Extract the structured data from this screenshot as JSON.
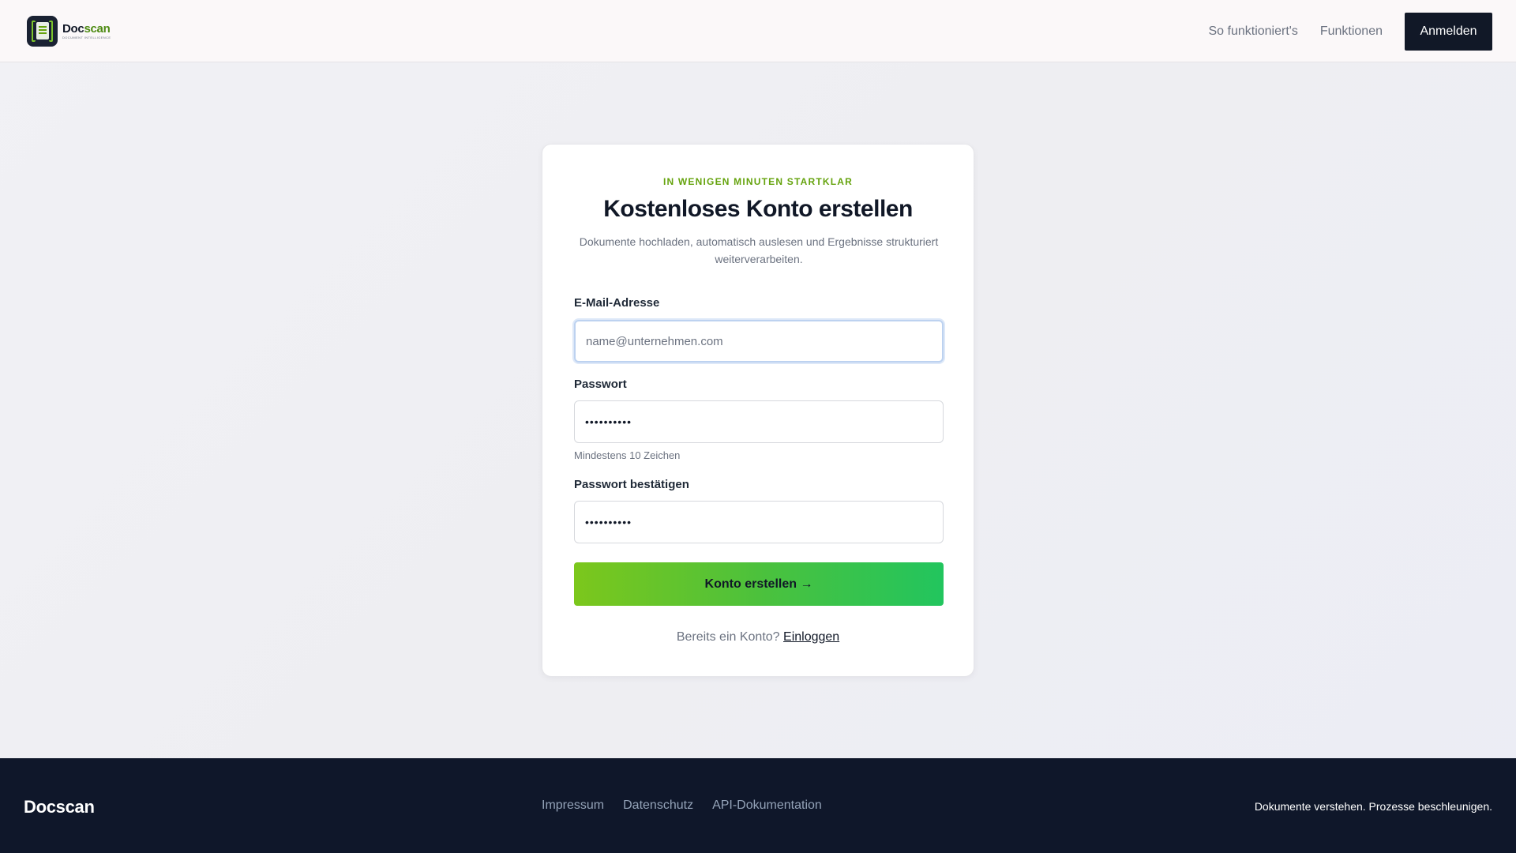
{
  "header": {
    "logo": {
      "name_main": "Doc",
      "name_accent": "scan",
      "tagline": "DOCUMENT INTELLIGENCE"
    },
    "nav": [
      {
        "label": "So funktioniert's"
      },
      {
        "label": "Funktionen"
      }
    ],
    "login_label": "Anmelden"
  },
  "form": {
    "eyebrow": "IN WENIGEN MINUTEN STARTKLAR",
    "title": "Kostenloses Konto erstellen",
    "subtitle": "Dokumente hochladen, automatisch auslesen und Ergebnisse strukturiert weiterverarbeiten.",
    "email": {
      "label": "E-Mail-Adresse",
      "placeholder": "name@unternehmen.com",
      "value": ""
    },
    "password": {
      "label": "Passwort",
      "value": "••••••••••",
      "hint": "Mindestens 10 Zeichen"
    },
    "confirm": {
      "label": "Passwort bestätigen",
      "value": "••••••••••"
    },
    "submit_label": "Konto erstellen →",
    "signin_prompt": "Bereits ein Konto?",
    "signin_link": "Einloggen"
  },
  "footer": {
    "brand": "Docscan",
    "links": [
      {
        "label": "Impressum"
      },
      {
        "label": "Datenschutz"
      },
      {
        "label": "API-Dokumentation"
      }
    ],
    "tagline": "Dokumente verstehen. Prozesse beschleunigen."
  },
  "colors": {
    "accent_green": "#65a30d",
    "button_gradient_start": "#7cc71c",
    "button_gradient_end": "#22c55e",
    "dark": "#111827",
    "footer_bg": "#0f172a"
  }
}
